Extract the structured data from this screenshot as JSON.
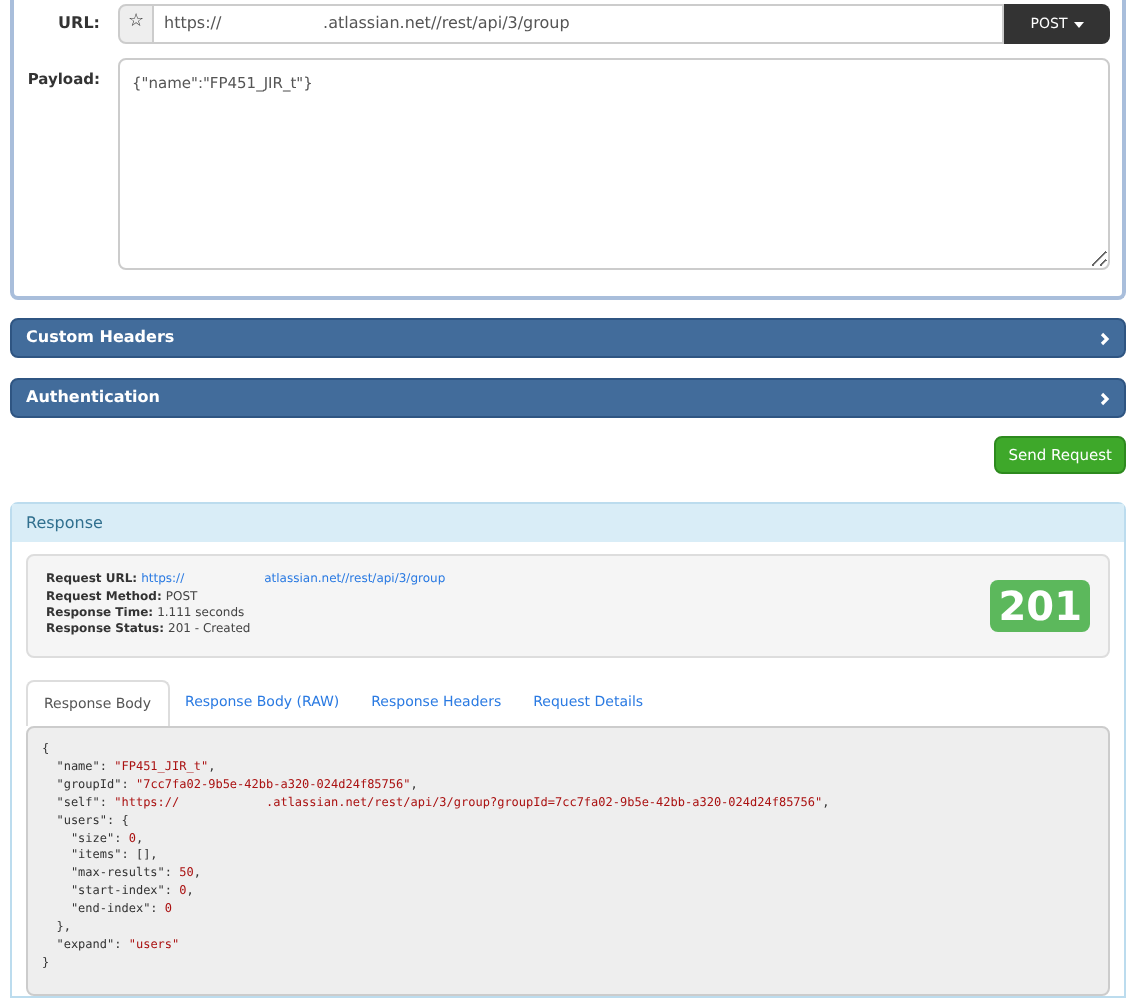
{
  "request": {
    "url_label": "URL:",
    "url_star": "☆",
    "url": "https://                    .atlassian.net//rest/api/3/group",
    "method": "POST",
    "payload_label": "Payload:",
    "payload": "{\"name\":\"FP451_JIR_t\"}"
  },
  "panels": [
    {
      "title": "Custom Headers",
      "expanded": false
    },
    {
      "title": "Authentication",
      "expanded": false
    }
  ],
  "send_button": "Send Request",
  "response": {
    "title": "Response",
    "info": [
      {
        "label": "Request URL:",
        "value": "https://",
        "value_2": "atlassian.net//rest/api/3/group",
        "kind": "link"
      },
      {
        "label": "Request Method:",
        "value": "POST",
        "kind": "text"
      },
      {
        "label": "Response Time:",
        "value": "1.111 seconds",
        "kind": "text"
      },
      {
        "label": "Response Status:",
        "value": "201 - Created",
        "kind": "text"
      }
    ],
    "status_code": "201",
    "tabs": [
      {
        "label": "Response Body",
        "selected": true
      },
      {
        "label": "Response Body (RAW)",
        "selected": false
      },
      {
        "label": "Response Headers",
        "selected": false
      },
      {
        "label": "Request Details",
        "selected": false
      }
    ],
    "body_lines": [
      [
        {
          "kind": "plain",
          "text": "{"
        }
      ],
      [
        {
          "kind": "plain",
          "text": "  \"name\": "
        },
        {
          "kind": "string",
          "text": "\"FP451_JIR_t\""
        },
        {
          "kind": "plain",
          "text": ","
        }
      ],
      [
        {
          "kind": "plain",
          "text": "  \"groupId\": "
        },
        {
          "kind": "string",
          "text": "\"7cc7fa02-9b5e-42bb-a320-024d24f85756\""
        },
        {
          "kind": "plain",
          "text": ","
        }
      ],
      [
        {
          "kind": "plain",
          "text": "  \"self\": "
        },
        {
          "kind": "string",
          "text": "\"https://            .atlassian.net/rest/api/3/group?groupId=7cc7fa02-9b5e-42bb-a320-024d24f85756\""
        },
        {
          "kind": "plain",
          "text": ","
        }
      ],
      [
        {
          "kind": "plain",
          "text": "  \"users\": {"
        }
      ],
      [
        {
          "kind": "plain",
          "text": "    \"size\": "
        },
        {
          "kind": "number",
          "text": "0"
        },
        {
          "kind": "plain",
          "text": ","
        }
      ],
      [
        {
          "kind": "plain",
          "text": "    \"items\": [],"
        }
      ],
      [
        {
          "kind": "plain",
          "text": "    \"max-results\": "
        },
        {
          "kind": "number",
          "text": "50"
        },
        {
          "kind": "plain",
          "text": ","
        }
      ],
      [
        {
          "kind": "plain",
          "text": "    \"start-index\": "
        },
        {
          "kind": "number",
          "text": "0"
        },
        {
          "kind": "plain",
          "text": ","
        }
      ],
      [
        {
          "kind": "plain",
          "text": "    \"end-index\": "
        },
        {
          "kind": "number",
          "text": "0"
        }
      ],
      [
        {
          "kind": "plain",
          "text": "  },"
        }
      ],
      [
        {
          "kind": "plain",
          "text": "  \"expand\": "
        },
        {
          "kind": "string",
          "text": "\"users\""
        }
      ],
      [
        {
          "kind": "plain",
          "text": "}"
        }
      ]
    ]
  }
}
